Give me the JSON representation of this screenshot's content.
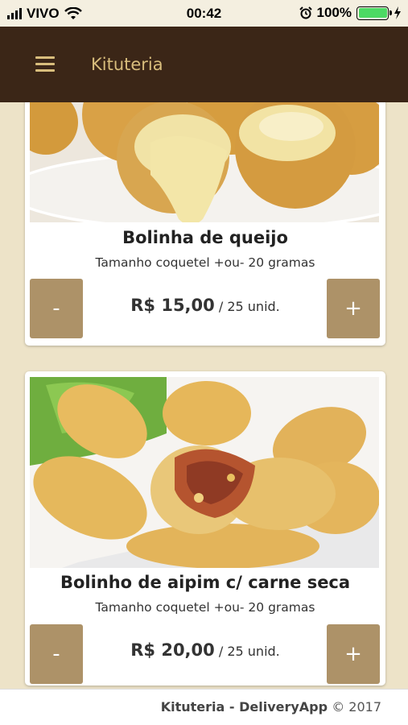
{
  "status_bar": {
    "carrier": "VIVO",
    "time": "00:42",
    "battery": "100%"
  },
  "app_bar": {
    "title": "Kituteria"
  },
  "products": [
    {
      "name": "Bolinha de queijo",
      "description": "Tamanho coquetel +ou- 20 gramas",
      "price": "R$ 15,00",
      "unit": "/ 25 unid.",
      "minus_label": "-",
      "plus_label": "+"
    },
    {
      "name": "Bolinho de aipim c/ carne seca",
      "description": "Tamanho coquetel +ou- 20 gramas",
      "price": "R$ 20,00",
      "unit": "/ 25 unid.",
      "minus_label": "-",
      "plus_label": "+"
    }
  ],
  "footer": {
    "brand": "Kituteria - DeliveryApp",
    "copyright": "© 2017"
  },
  "colors": {
    "app_bar": "#3b2617",
    "accent": "#d8bd7c",
    "button": "#ad9268",
    "background": "#ede3c8"
  }
}
